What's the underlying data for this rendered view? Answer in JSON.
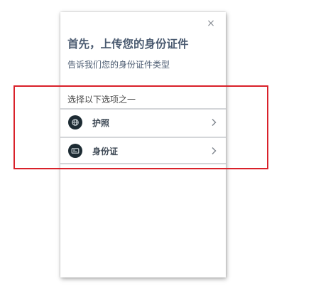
{
  "dialog": {
    "close_label": "×",
    "title": "首先，上传您的身份证件",
    "subtitle": "告诉我们您的身份证件类型",
    "options_heading": "选择以下选项之一",
    "options": [
      {
        "label": "护照",
        "icon": "passport-icon"
      },
      {
        "label": "身份证",
        "icon": "id-card-icon"
      }
    ]
  },
  "colors": {
    "title": "#4a5a70",
    "icon_circle": "#1d2b33",
    "highlight_border": "#d9212a",
    "divider": "#d4d6d9"
  }
}
